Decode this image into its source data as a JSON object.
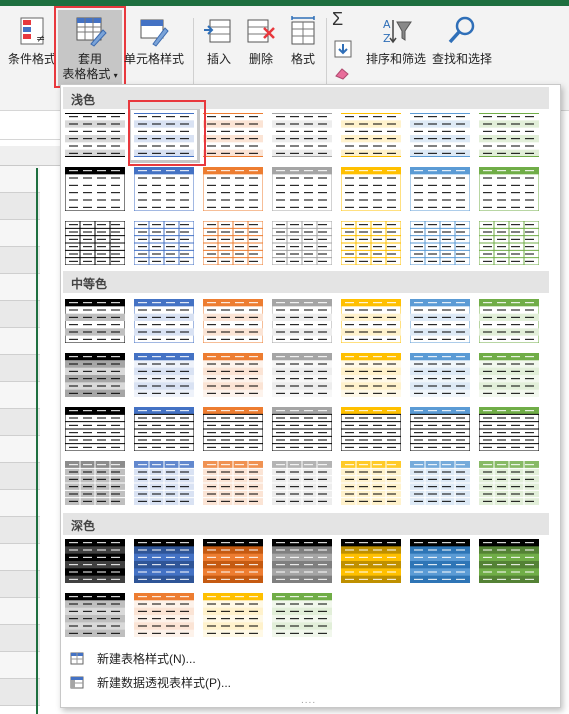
{
  "ribbon": {
    "conditional_format": "条件格式",
    "format_as_table_line1": "套用",
    "format_as_table_line2": "表格格式",
    "caret": "▾",
    "cell_styles": "单元格样式",
    "insert": "插入",
    "delete": "删除",
    "format": "格式",
    "sum_symbol": "Σ",
    "sort_filter": "排序和筛选",
    "find_select": "查找和选择"
  },
  "gallery": {
    "sections": [
      {
        "label": "浅色",
        "key": "light"
      },
      {
        "label": "中等色",
        "key": "medium"
      },
      {
        "label": "深色",
        "key": "dark"
      }
    ],
    "palette": [
      "#000000",
      "#4472c4",
      "#ed7d31",
      "#a5a5a5",
      "#ffc000",
      "#5b9bd5",
      "#70ad47"
    ],
    "light_palette": [
      "#ffffff",
      "#d9e2f3",
      "#fbe4d5",
      "#ededed",
      "#fff2cc",
      "#deeaf6",
      "#e2efd9"
    ],
    "dark_palette": [
      "#404040",
      "#2f5597",
      "#c55a11",
      "#7f7f7f",
      "#bf9000",
      "#2e75b6",
      "#548235"
    ],
    "menu": [
      {
        "label": "新建表格样式(N)...",
        "icon": "new-table-style-icon"
      },
      {
        "label": "新建数据透视表样式(P)...",
        "icon": "new-pivot-style-icon"
      }
    ],
    "grip": "....",
    "selected_tile": "light-2"
  }
}
